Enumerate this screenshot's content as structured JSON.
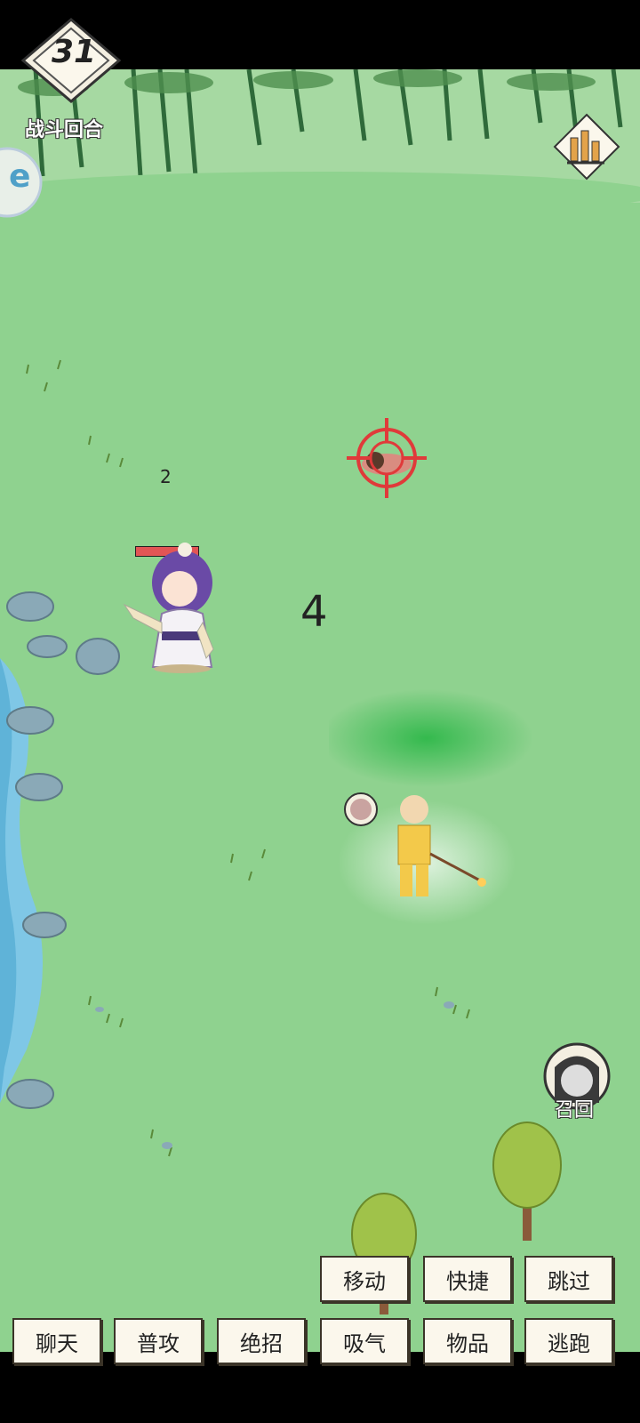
{
  "round": {
    "number": "31",
    "label": "战斗回合"
  },
  "side_tab": {
    "text": "e"
  },
  "field": {
    "enemy_count_label": "2",
    "center_number": "4",
    "hero_hp_fraction": 1.0
  },
  "summon": {
    "label": "召回"
  },
  "actions": {
    "row1": {
      "move": "移动",
      "shortcut": "快捷",
      "skip": "跳过"
    },
    "row2": {
      "chat": "聊天",
      "attack": "普攻",
      "ultimate": "绝招",
      "breathe": "吸气",
      "items": "物品",
      "flee": "逃跑"
    }
  },
  "colors": {
    "grass": "#8fd28f",
    "water": "#7fc7e6",
    "target_red": "#e03a3a",
    "button_bg": "#fbf7ec"
  },
  "icons": {
    "stats": "bar-chart-icon",
    "summon_avatar": "avatar-icon",
    "target": "crosshair-icon"
  }
}
